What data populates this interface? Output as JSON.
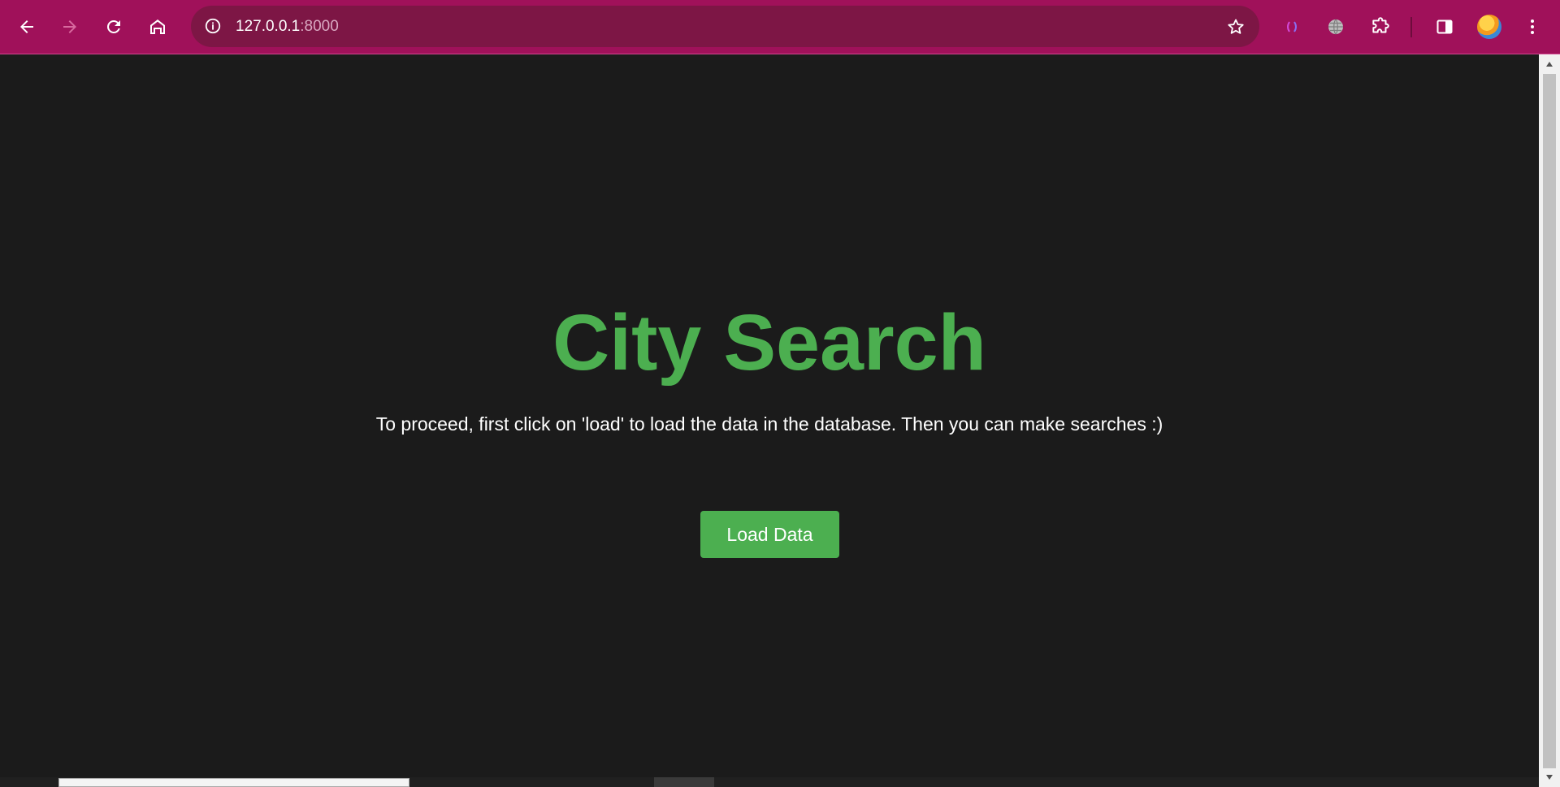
{
  "browser": {
    "url_host": "127.0.0.1",
    "url_port": ":8000",
    "theme_color": "#a0115a"
  },
  "icons": {
    "back": "arrow-left",
    "forward": "arrow-right",
    "reload": "reload",
    "home": "home",
    "site_info": "info-circle",
    "bookmark": "star-outline",
    "extension_1": "bracket-extension",
    "extension_2": "globe",
    "extensions": "puzzle",
    "side_panel": "side-panel",
    "menu": "three-dots-vertical"
  },
  "page": {
    "title": "City Search",
    "instructions": "To proceed, first click on 'load' to load the data in the database. Then you can make searches :)",
    "load_button_label": "Load Data",
    "accent_color": "#4caf50",
    "background_color": "#1b1b1b"
  }
}
